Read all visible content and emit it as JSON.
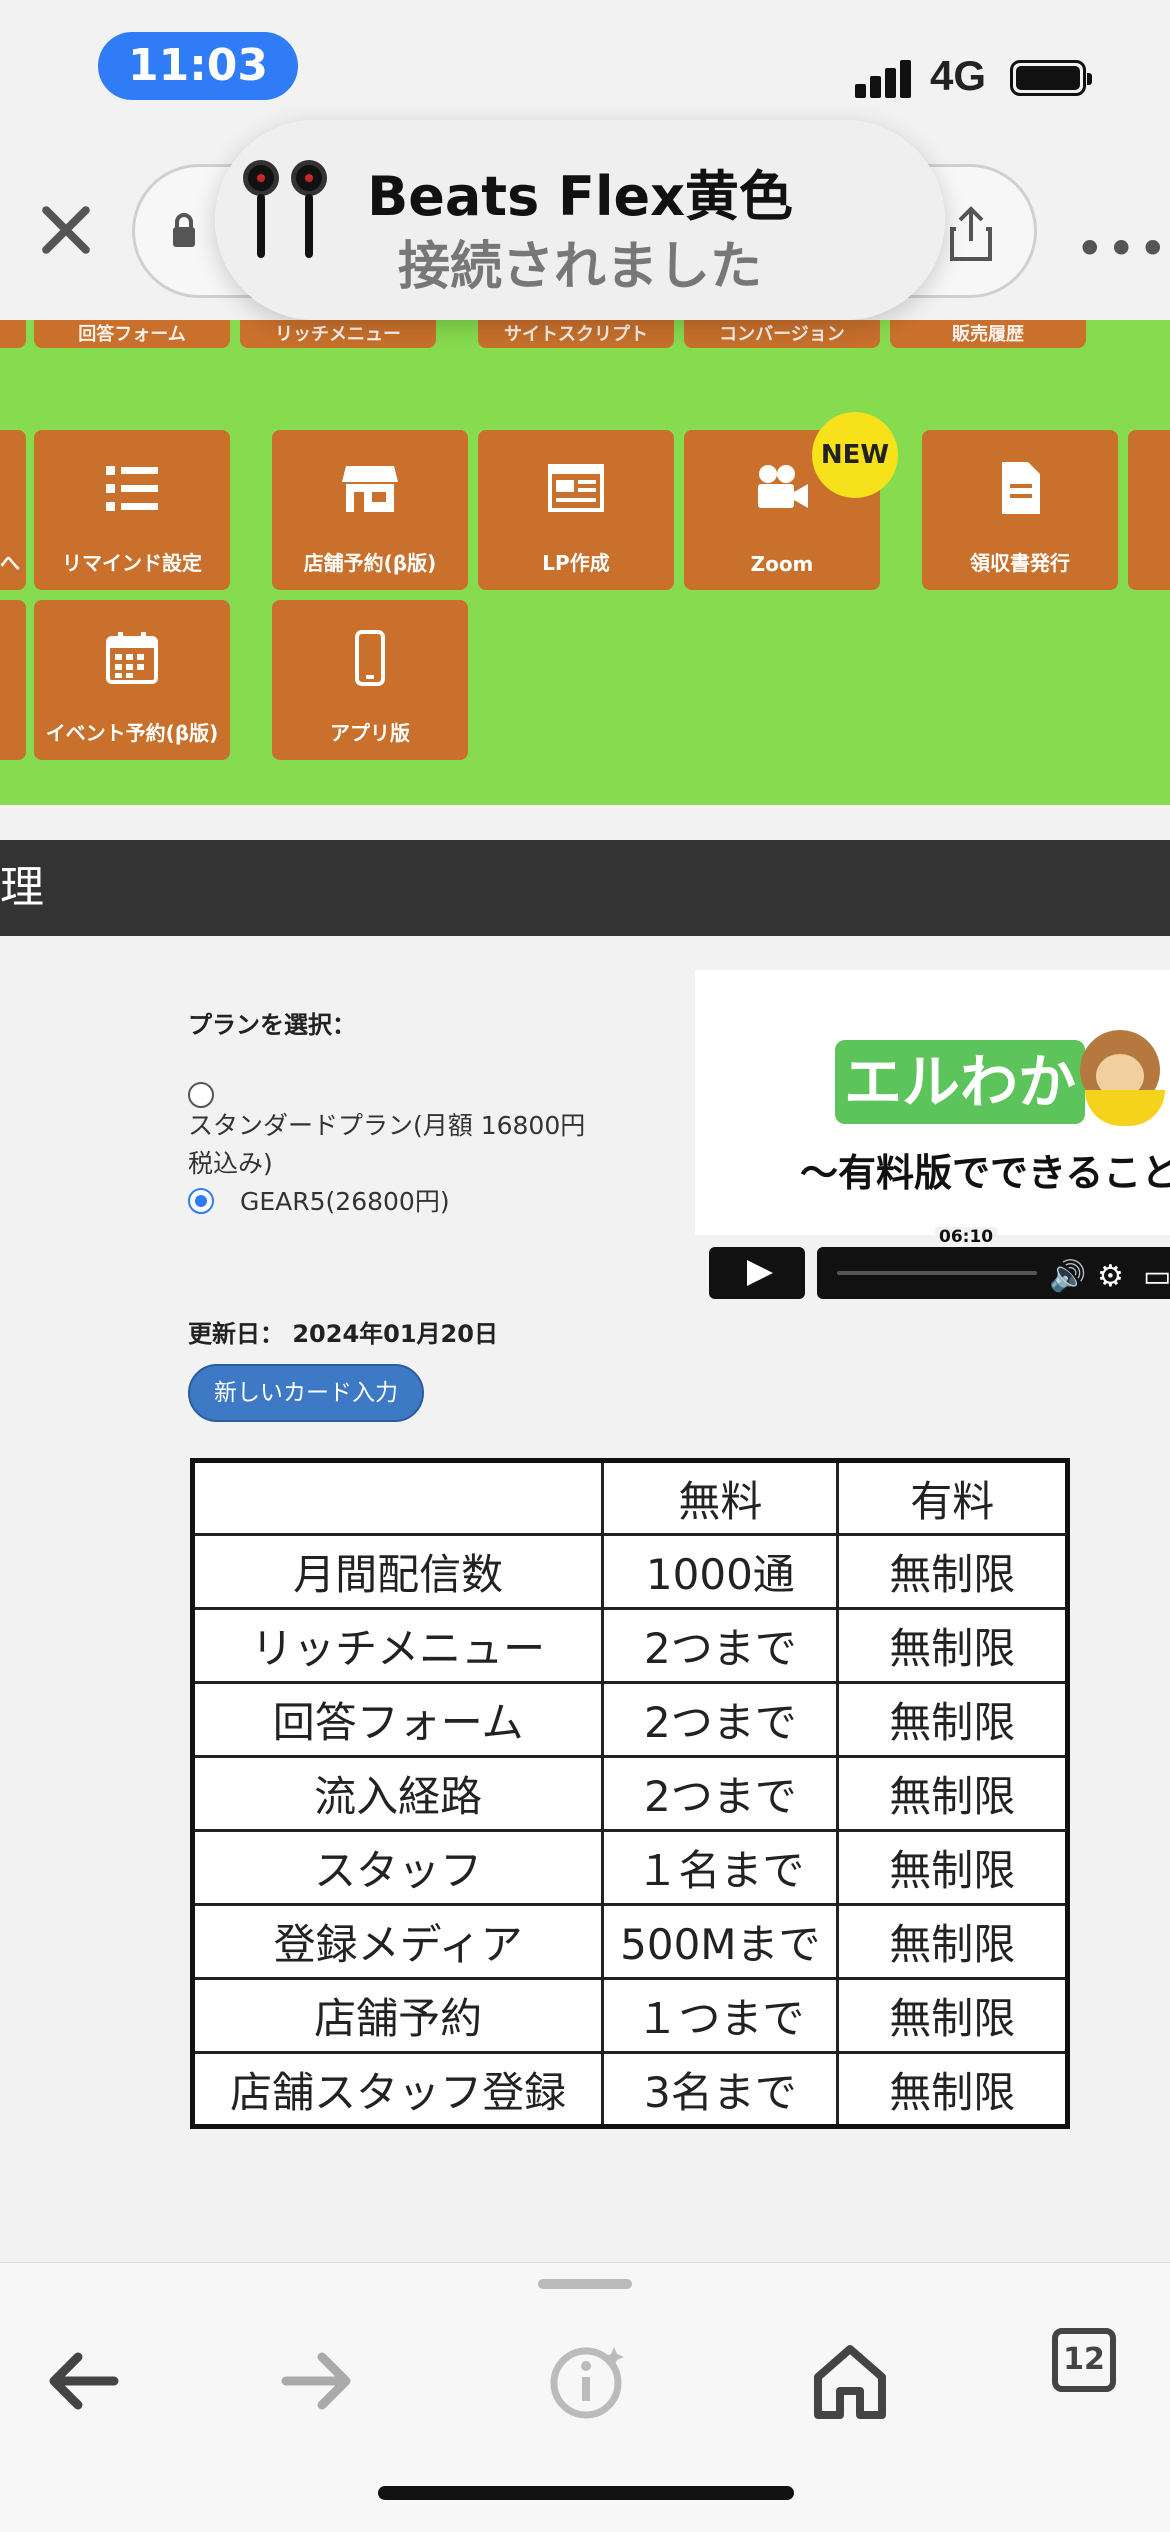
{
  "status_bar": {
    "time": "11:03",
    "network": "4G"
  },
  "hud": {
    "title": "Beats Flex黄色",
    "subtitle": "接続されました"
  },
  "menu": {
    "top_row_partial": [
      "回答フォーム",
      "リッチメニュー",
      "サイトスクリプト",
      "コンバージョン",
      "販売履歴"
    ],
    "tiles_row1": [
      {
        "label": "リマインド設定",
        "icon": "list-icon"
      },
      {
        "label": "店舗予約(β版)",
        "icon": "store-icon"
      },
      {
        "label": "LP作成",
        "icon": "webpage-icon"
      },
      {
        "label": "Zoom",
        "icon": "video-camera-icon"
      },
      {
        "label": "領収書発行",
        "icon": "document-icon"
      }
    ],
    "tiles_row2": [
      {
        "label": "イベント予約(β版)",
        "icon": "calendar-icon"
      },
      {
        "label": "アプリ版",
        "icon": "smartphone-icon"
      }
    ],
    "left_cut_label": "へ",
    "new_badge": "NEW"
  },
  "section_header": "理",
  "plan": {
    "label": "プランを選択：",
    "options": [
      {
        "text_line1": "スタンダードプラン(月額 16800円",
        "text_line2": "税込み)",
        "selected": false
      },
      {
        "text": "GEAR5(26800円)",
        "selected": true
      }
    ],
    "updated_label": "更新日： 2024年01月20日",
    "new_card_button": "新しいカード入力"
  },
  "video": {
    "logo_text": "エルわか",
    "caption": "〜有料版でできること〜",
    "duration": "06:10"
  },
  "comparison_table": {
    "headers": [
      "",
      "無料",
      "有料"
    ],
    "rows": [
      [
        "月間配信数",
        "1000通",
        "無制限"
      ],
      [
        "リッチメニュー",
        "2つまで",
        "無制限"
      ],
      [
        "回答フォーム",
        "2つまで",
        "無制限"
      ],
      [
        "流入経路",
        "2つまで",
        "無制限"
      ],
      [
        "スタッフ",
        "１名まで",
        "無制限"
      ],
      [
        "登録メディア",
        "500Mまで",
        "無制限"
      ],
      [
        "店舗予約",
        "１つまで",
        "無制限"
      ],
      [
        "店舗スタッフ登録",
        "3名まで",
        "無制限"
      ]
    ]
  },
  "toolbar": {
    "tab_count": "12"
  },
  "colors": {
    "green_bg": "#86db4e",
    "tile": "#c8702c",
    "accent_blue": "#2f7cf6",
    "dark_header": "#333333",
    "new_badge": "#f7e11a"
  }
}
